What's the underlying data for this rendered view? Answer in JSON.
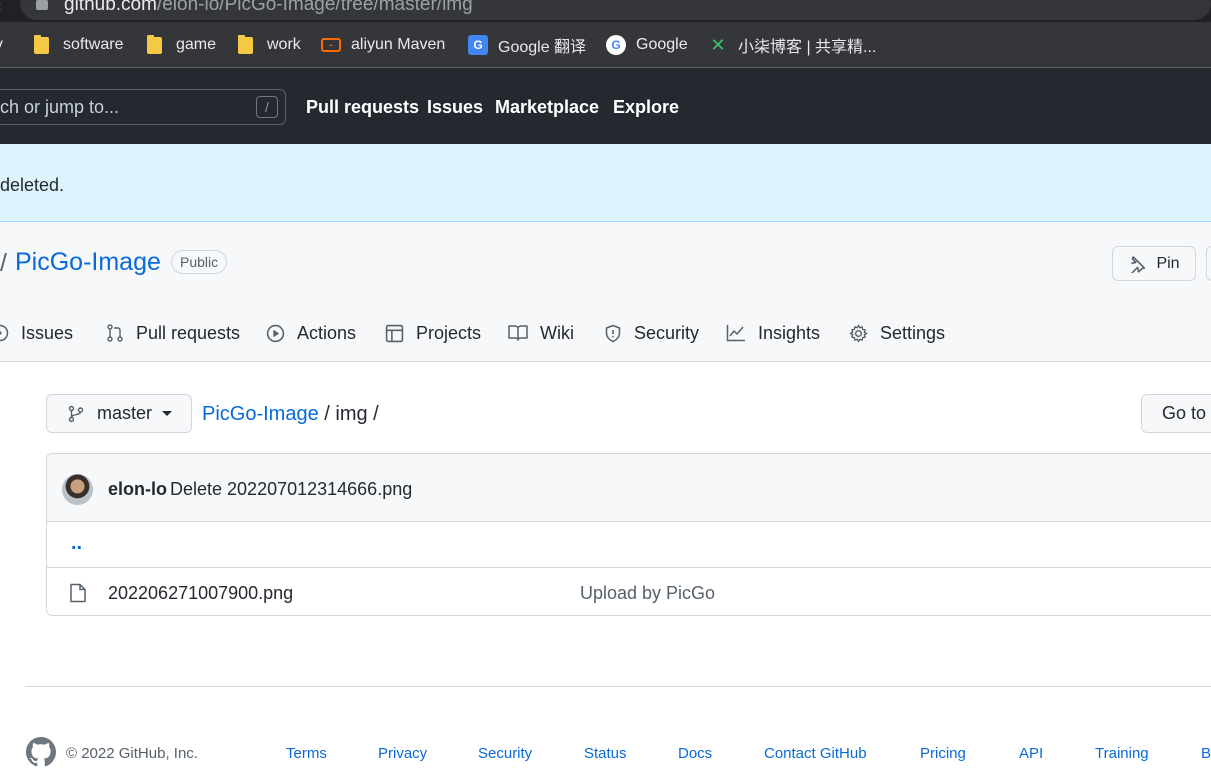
{
  "browser": {
    "url_host": "github.com",
    "url_path": "/elon-lo/PicGo-Image/tree/master/img",
    "bookmarks": [
      {
        "label": "dy",
        "icon": "folder-icon"
      },
      {
        "label": "software",
        "icon": "folder-icon"
      },
      {
        "label": "game",
        "icon": "folder-icon"
      },
      {
        "label": "work",
        "icon": "folder-icon"
      },
      {
        "label": "aliyun Maven",
        "icon": "aliyun-icon"
      },
      {
        "label": "Google 翻译",
        "icon": "google-translate-icon"
      },
      {
        "label": "Google",
        "icon": "google-icon"
      },
      {
        "label": "小柒博客 | 共享精...",
        "icon": "xq-blog-icon"
      }
    ]
  },
  "header": {
    "search_placeholder": "ch or jump to...",
    "search_hotkey": "/",
    "nav": [
      "Pull requests",
      "Issues",
      "Marketplace",
      "Explore"
    ]
  },
  "flash": {
    "message": "deleted."
  },
  "repo": {
    "separator": "/",
    "name": "PicGo-Image",
    "visibility": "Public",
    "pin_label": "Pin",
    "tabs": [
      {
        "label": "Issues",
        "icon": "issue-icon"
      },
      {
        "label": "Pull requests",
        "icon": "pull-request-icon"
      },
      {
        "label": "Actions",
        "icon": "actions-icon"
      },
      {
        "label": "Projects",
        "icon": "projects-icon"
      },
      {
        "label": "Wiki",
        "icon": "wiki-icon"
      },
      {
        "label": "Security",
        "icon": "shield-icon"
      },
      {
        "label": "Insights",
        "icon": "graph-icon"
      },
      {
        "label": "Settings",
        "icon": "gear-icon"
      }
    ]
  },
  "file_nav": {
    "branch": "master",
    "breadcrumb_repo": "PicGo-Image",
    "breadcrumb_rest": " / img /",
    "goto_label": "Go to"
  },
  "files": {
    "latest_commit": {
      "author": "elon-lo",
      "message": "Delete 202207012314666.png"
    },
    "parent_dir": "..",
    "rows": [
      {
        "name": "202206271007900.png",
        "commit_message": "Upload by PicGo"
      }
    ]
  },
  "footer": {
    "copyright": "© 2022 GitHub, Inc.",
    "links": [
      "Terms",
      "Privacy",
      "Security",
      "Status",
      "Docs",
      "Contact GitHub",
      "Pricing",
      "API",
      "Training",
      "B"
    ]
  },
  "colors": {
    "link": "#0969da",
    "header_bg": "#24292f",
    "flash_bg": "#ddf4ff"
  }
}
